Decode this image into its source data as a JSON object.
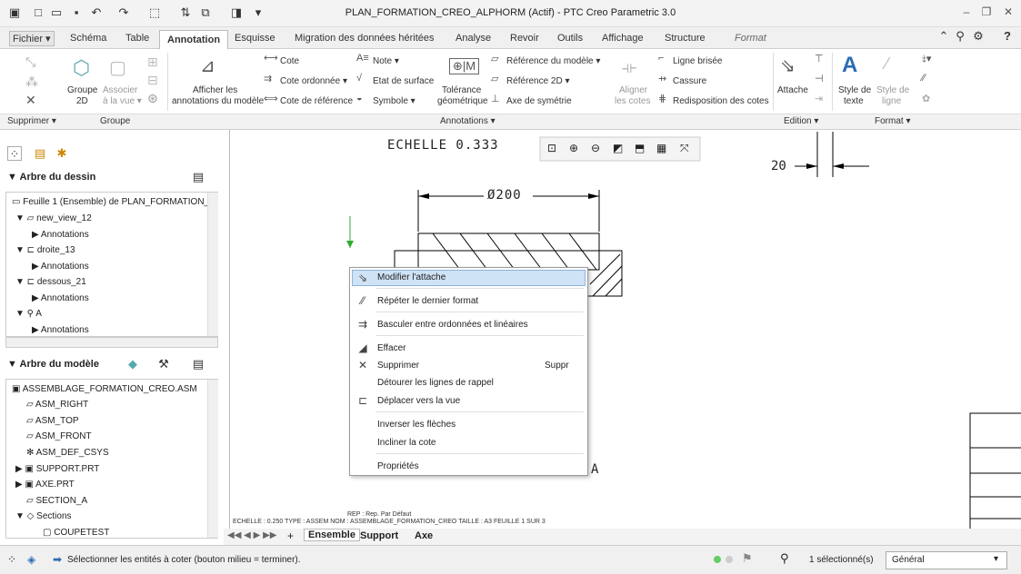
{
  "window": {
    "title": "PLAN_FORMATION_CREO_ALPHORM (Actif) - PTC Creo Parametric 3.0"
  },
  "tabs": [
    "Fichier ▾",
    "Schéma",
    "Table",
    "Annotation",
    "Esquisse",
    "Migration des données héritées",
    "Analyse",
    "Revoir",
    "Outils",
    "Affichage",
    "Structure",
    "Format"
  ],
  "ribbon": {
    "groupe": {
      "label1": "Groupe",
      "label2": "2D",
      "assoc1": "Associer",
      "assoc2": "à la vue ▾"
    },
    "afficher": {
      "l1": "Afficher les",
      "l2": "annotations du modèle"
    },
    "cote": "Cote",
    "cote_ordonnee": "Cote ordonnée ▾",
    "cote_reference": "Cote de référence",
    "note": "Note ▾",
    "etat_surface": "Etat de surface",
    "symbole": "Symbole ▾",
    "tolerance": {
      "l1": "Tolérance",
      "l2": "géométrique"
    },
    "ref_modele": "Référence du modèle ▾",
    "ref_2d": "Référence 2D ▾",
    "axe_symetrie": "Axe de symétrie",
    "aligner": {
      "l1": "Aligner",
      "l2": "les cotes"
    },
    "ligne_brisee": "Ligne brisée",
    "cassure": "Cassure",
    "redisposition": "Redisposition des cotes",
    "attache": "Attache",
    "style_texte": {
      "l1": "Style de",
      "l2": "texte"
    },
    "style_ligne": {
      "l1": "Style de",
      "l2": "ligne"
    }
  },
  "groups": {
    "supprimer": "Supprimer ▾",
    "groupe": "Groupe",
    "annotations": "Annotations ▾",
    "edition": "Edition ▾",
    "format": "Format ▾"
  },
  "drawing_tree": {
    "title": "Arbre du dessin",
    "items": [
      "Feuille 1 (Ensemble) de PLAN_FORMATION_C",
      "new_view_12",
      "Annotations",
      "droite_13",
      "Annotations",
      "dessous_21",
      "Annotations",
      "A",
      "Annotations"
    ]
  },
  "model_tree": {
    "title": "Arbre du modèle",
    "items": [
      "ASSEMBLAGE_FORMATION_CREO.ASM",
      "ASM_RIGHT",
      "ASM_TOP",
      "ASM_FRONT",
      "ASM_DEF_CSYS",
      "SUPPORT.PRT",
      "AXE.PRT",
      "SECTION_A",
      "Sections",
      "COUPETEST"
    ]
  },
  "drawing": {
    "scale": "ECHELLE  0.333",
    "dim_diameter": "Ø200",
    "dim_20": "20",
    "label_a": "A",
    "footer": "ECHELLE : 0.250    TYPE : ASSEM    NOM : ASSEMBLAGE_FORMATION_CREO    TAILLE : A3    FEUILLE 1  SUR 3",
    "footer_rep": "REP : Rep. Par Défaut"
  },
  "context_menu": {
    "items": [
      {
        "label": "Modifier l'attache",
        "shortcut": ""
      },
      {
        "label": "Répéter le dernier format",
        "shortcut": ""
      },
      {
        "label": "Basculer entre ordonnées et linéaires",
        "shortcut": ""
      },
      {
        "label": "Effacer",
        "shortcut": ""
      },
      {
        "label": "Supprimer",
        "shortcut": "Suppr"
      },
      {
        "label": "Détourer les lignes de rappel",
        "shortcut": ""
      },
      {
        "label": "Déplacer vers la vue",
        "shortcut": ""
      },
      {
        "label": "Inverser les flèches",
        "shortcut": ""
      },
      {
        "label": "Incliner la cote",
        "shortcut": ""
      },
      {
        "label": "Propriétés",
        "shortcut": ""
      }
    ]
  },
  "sheet_tabs": [
    "Ensemble",
    "Support",
    "Axe"
  ],
  "status": {
    "message": "Sélectionner les entités à coter (bouton milieu = terminer).",
    "selection": "1 sélectionné(s)",
    "filter": "Général"
  },
  "colors": {
    "accent_tab": "#ffffff",
    "menu_hover": "#cfe3f7",
    "drawing_line": "#000000"
  }
}
